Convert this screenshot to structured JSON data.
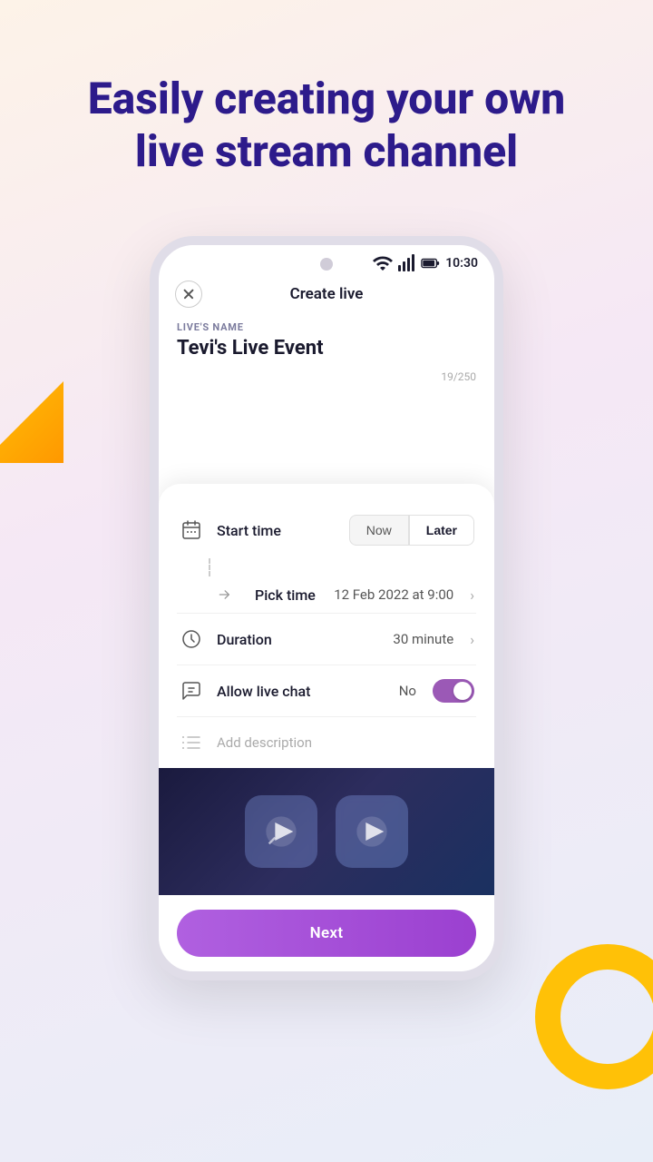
{
  "header": {
    "title_line1": "Easily creating your own",
    "title_line2": "live stream channel"
  },
  "status_bar": {
    "time": "10:30"
  },
  "screen": {
    "title": "Create live",
    "live_name_label": "LIVE'S NAME",
    "live_name_value": "Tevi's Live Event",
    "char_count": "19/250",
    "start_time_label": "Start time",
    "now_btn": "Now",
    "later_btn": "Later",
    "pick_time_label": "Pick time",
    "pick_time_value": "12 Feb 2022 at 9:00",
    "duration_label": "Duration",
    "duration_value": "30 minute",
    "allow_chat_label": "Allow live chat",
    "allow_chat_value": "No",
    "description_placeholder": "Add description",
    "next_btn": "Next"
  }
}
